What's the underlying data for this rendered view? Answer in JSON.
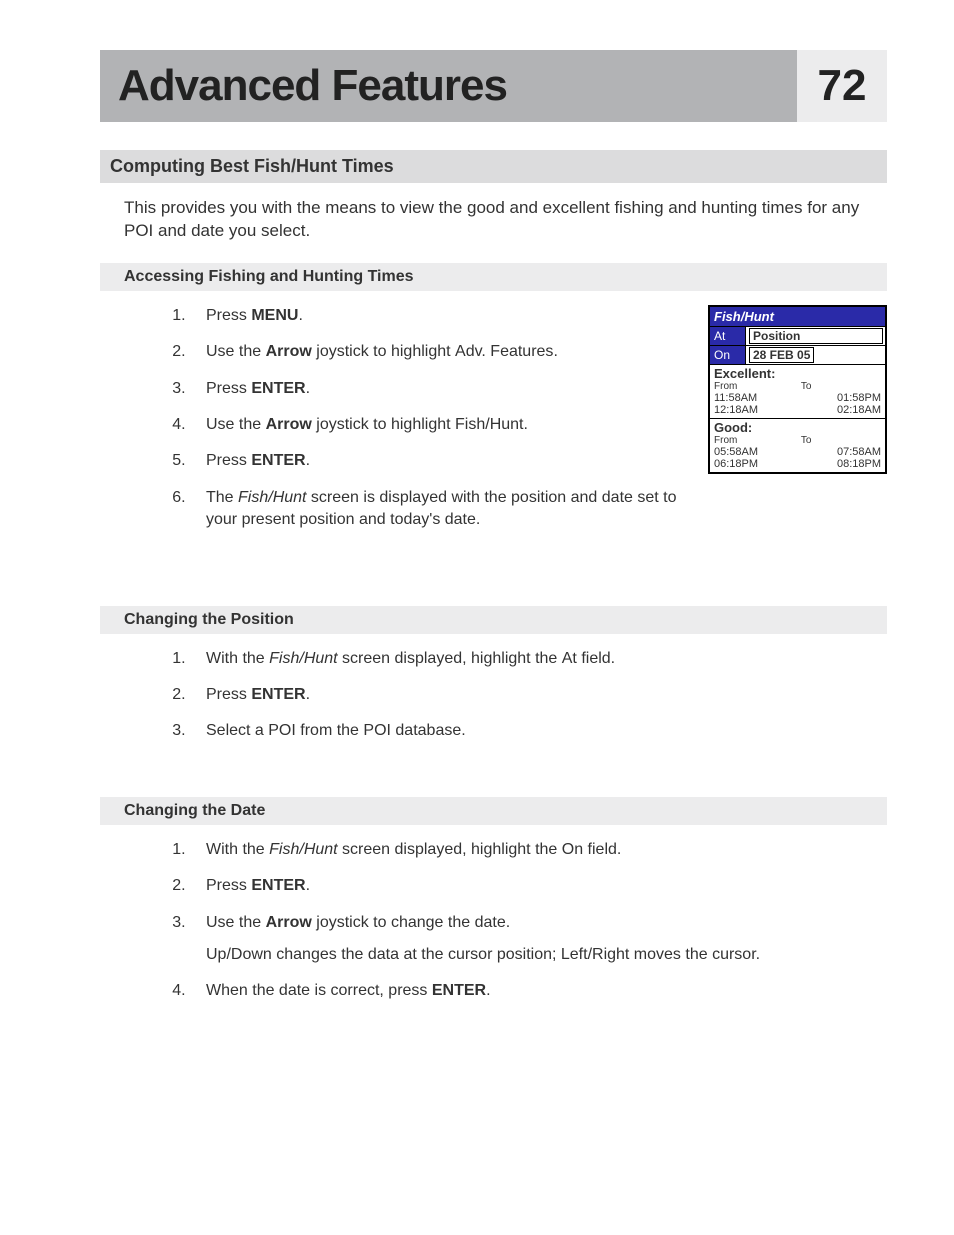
{
  "header": {
    "title": "Advanced Features",
    "page_number": "72"
  },
  "section_title": "Computing Best Fish/Hunt Times",
  "intro": "This provides you with the means to view the good and excellent fishing and hunting times for any POI and date you select.",
  "subsection_access": "Accessing Fishing and Hunting Times",
  "access_steps": {
    "s1a": "Press ",
    "s1b": "MENU",
    "s1c": ".",
    "s2a": "Use the ",
    "s2b": "Arrow",
    "s2c": " joystick to highlight ",
    "s2d": "Adv. Features",
    "s2e": ".",
    "s3a": "Press ",
    "s3b": "ENTER",
    "s3c": ".",
    "s4a": "Use the ",
    "s4b": "Arrow",
    "s4c": " joystick to highlight ",
    "s4d": "Fish/Hunt",
    "s4e": ".",
    "s5a": "Press ",
    "s5b": "ENTER",
    "s5c": ".",
    "s6a": "The ",
    "s6b": "Fish/Hunt",
    "s6c": " screen is displayed with the position and date set to your present position and today's date."
  },
  "fishhunt_screen": {
    "title": "Fish/Hunt",
    "at_label": "At",
    "at_value": "Position",
    "on_label": "On",
    "on_value": "28 FEB 05",
    "excellent_label": "Excellent:",
    "from_label": "From",
    "to_label": "To",
    "exc_from1": "11:58AM",
    "exc_to1": "01:58PM",
    "exc_from2": "12:18AM",
    "exc_to2": "02:18AM",
    "good_label": "Good:",
    "good_from1": "05:58AM",
    "good_to1": "07:58AM",
    "good_from2": "06:18PM",
    "good_to2": "08:18PM"
  },
  "subsection_position": "Changing the Position",
  "position_steps": {
    "s1a": "With the ",
    "s1b": "Fish/Hunt",
    "s1c": " screen displayed, highlight the ",
    "s1d": "At",
    "s1e": " field.",
    "s2a": "Press ",
    "s2b": "ENTER",
    "s2c": ".",
    "s3": "Select a POI from the POI database."
  },
  "subsection_date": "Changing the Date",
  "date_steps": {
    "s1a": "With the ",
    "s1b": "Fish/Hunt",
    "s1c": " screen displayed, highlight the ",
    "s1d": "On",
    "s1e": " field.",
    "s2a": "Press ",
    "s2b": "ENTER",
    "s2c": ".",
    "s3a": "Use the ",
    "s3b": "Arrow",
    "s3c": " joystick to change the date.",
    "s3d": "Up/Down changes the data at the cursor position; Left/Right moves the cursor.",
    "s4a": "When the date is correct, press ",
    "s4b": "ENTER",
    "s4c": "."
  }
}
